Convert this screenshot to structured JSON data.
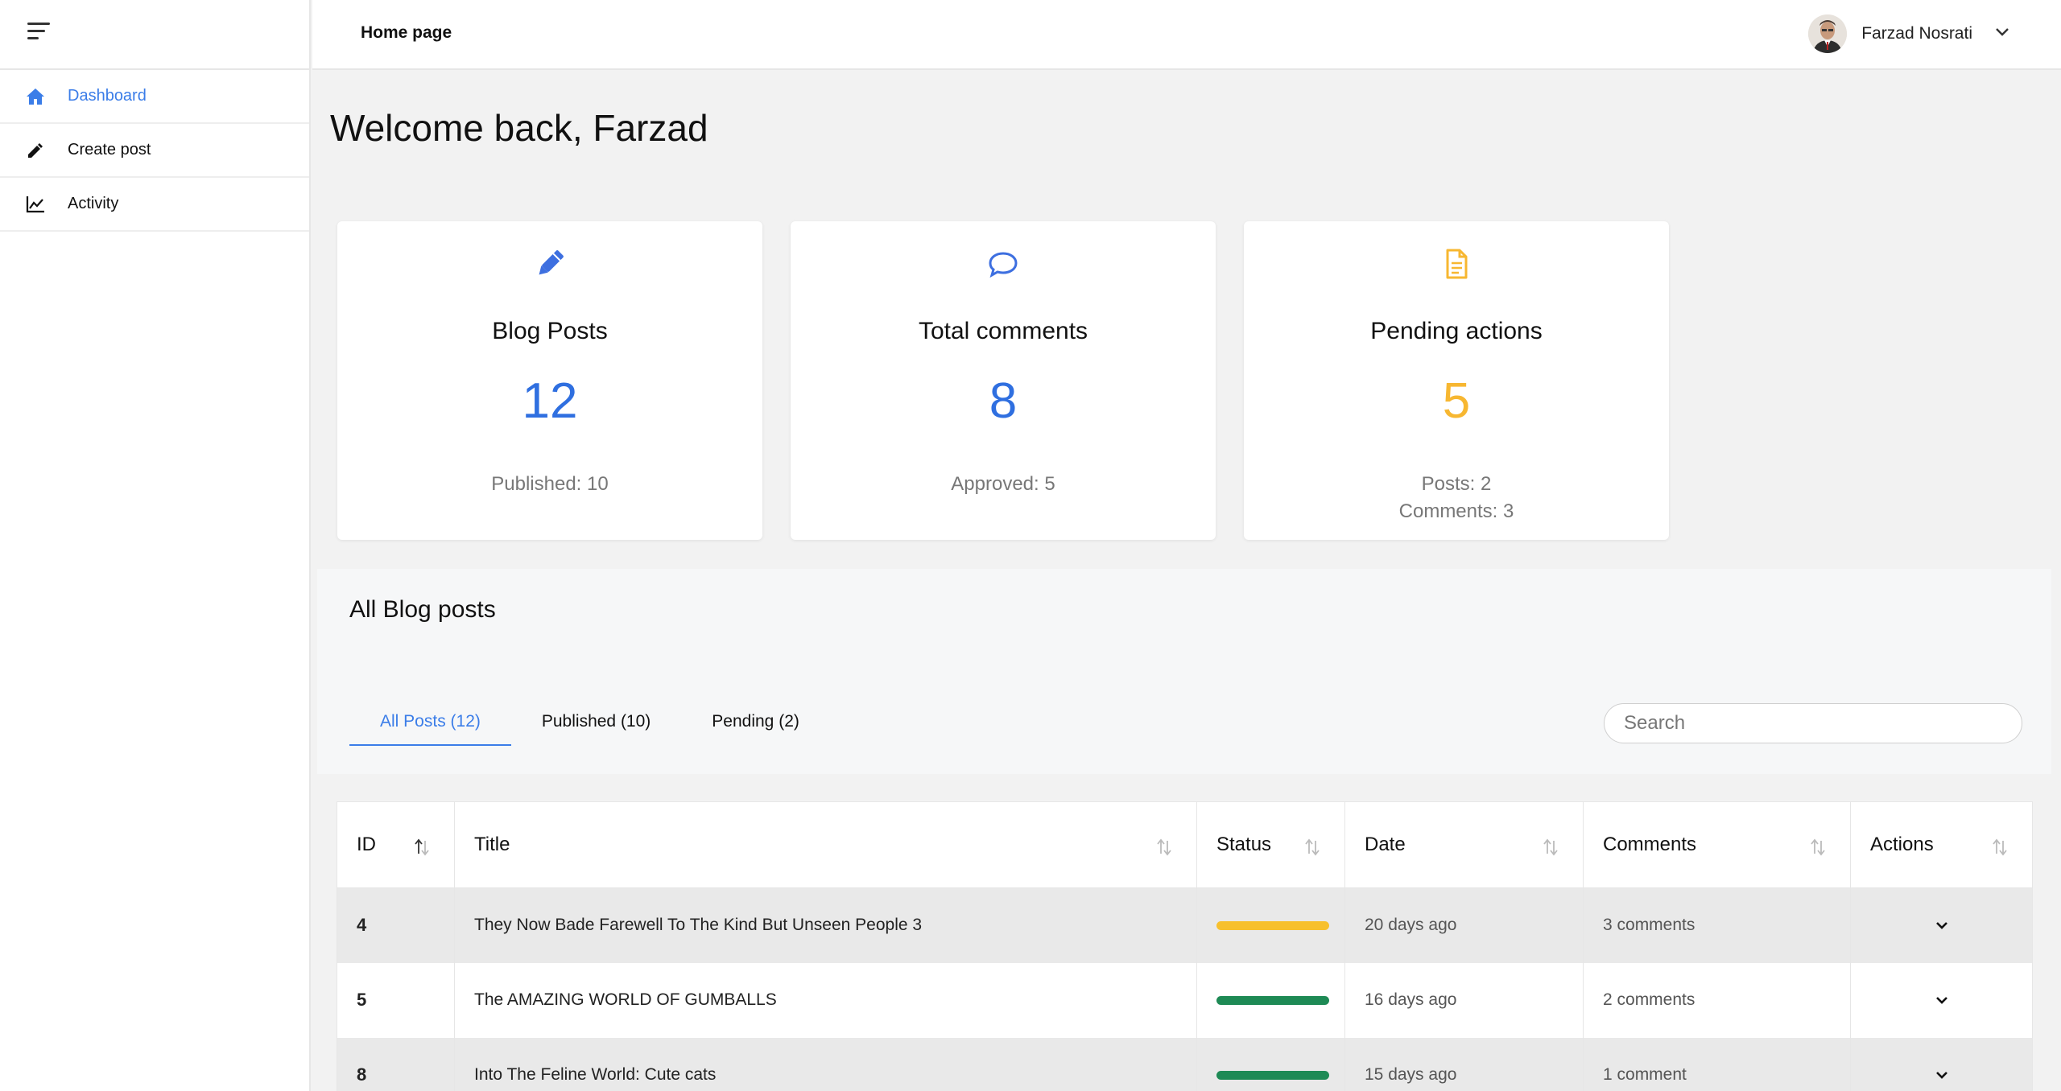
{
  "header": {
    "title": "Home page",
    "user_name": "Farzad Nosrati"
  },
  "sidebar": {
    "items": [
      {
        "label": "Dashboard",
        "icon": "home-icon",
        "active": true
      },
      {
        "label": "Create post",
        "icon": "pencil-icon",
        "active": false
      },
      {
        "label": "Activity",
        "icon": "chart-icon",
        "active": false
      }
    ]
  },
  "welcome": "Welcome back, Farzad",
  "cards": [
    {
      "title": "Blog Posts",
      "value": "12",
      "sub1": "Published: 10",
      "sub2": "",
      "icon": "pencil-icon",
      "color": "#2f6fe0"
    },
    {
      "title": "Total comments",
      "value": "8",
      "sub1": "Approved: 5",
      "sub2": "",
      "icon": "chat-icon",
      "color": "#2f6fe0"
    },
    {
      "title": "Pending actions",
      "value": "5",
      "sub1": "Posts: 2",
      "sub2": "Comments: 3",
      "icon": "document-icon",
      "color": "#f7b731"
    }
  ],
  "posts": {
    "heading": "All Blog posts",
    "tabs": [
      {
        "label": "All Posts (12)",
        "active": true
      },
      {
        "label": "Published (10)",
        "active": false
      },
      {
        "label": "Pending (2)",
        "active": false
      }
    ],
    "search_placeholder": "Search",
    "columns": [
      "ID",
      "Title",
      "Status",
      "Date",
      "Comments",
      "Actions"
    ],
    "rows": [
      {
        "id": "4",
        "title": "They Now Bade Farewell To The Kind But Unseen People 3",
        "status": "pending",
        "date": "20 days ago",
        "comments": "3 comments"
      },
      {
        "id": "5",
        "title": "The AMAZING WORLD OF GUMBALLS",
        "status": "published",
        "date": "16 days ago",
        "comments": "2 comments"
      },
      {
        "id": "8",
        "title": "Into The Feline World: Cute cats",
        "status": "published",
        "date": "15 days ago",
        "comments": "1 comment"
      }
    ]
  },
  "colors": {
    "accent": "#3b7de8",
    "pending": "#f7c02d",
    "published": "#1e8a55"
  }
}
